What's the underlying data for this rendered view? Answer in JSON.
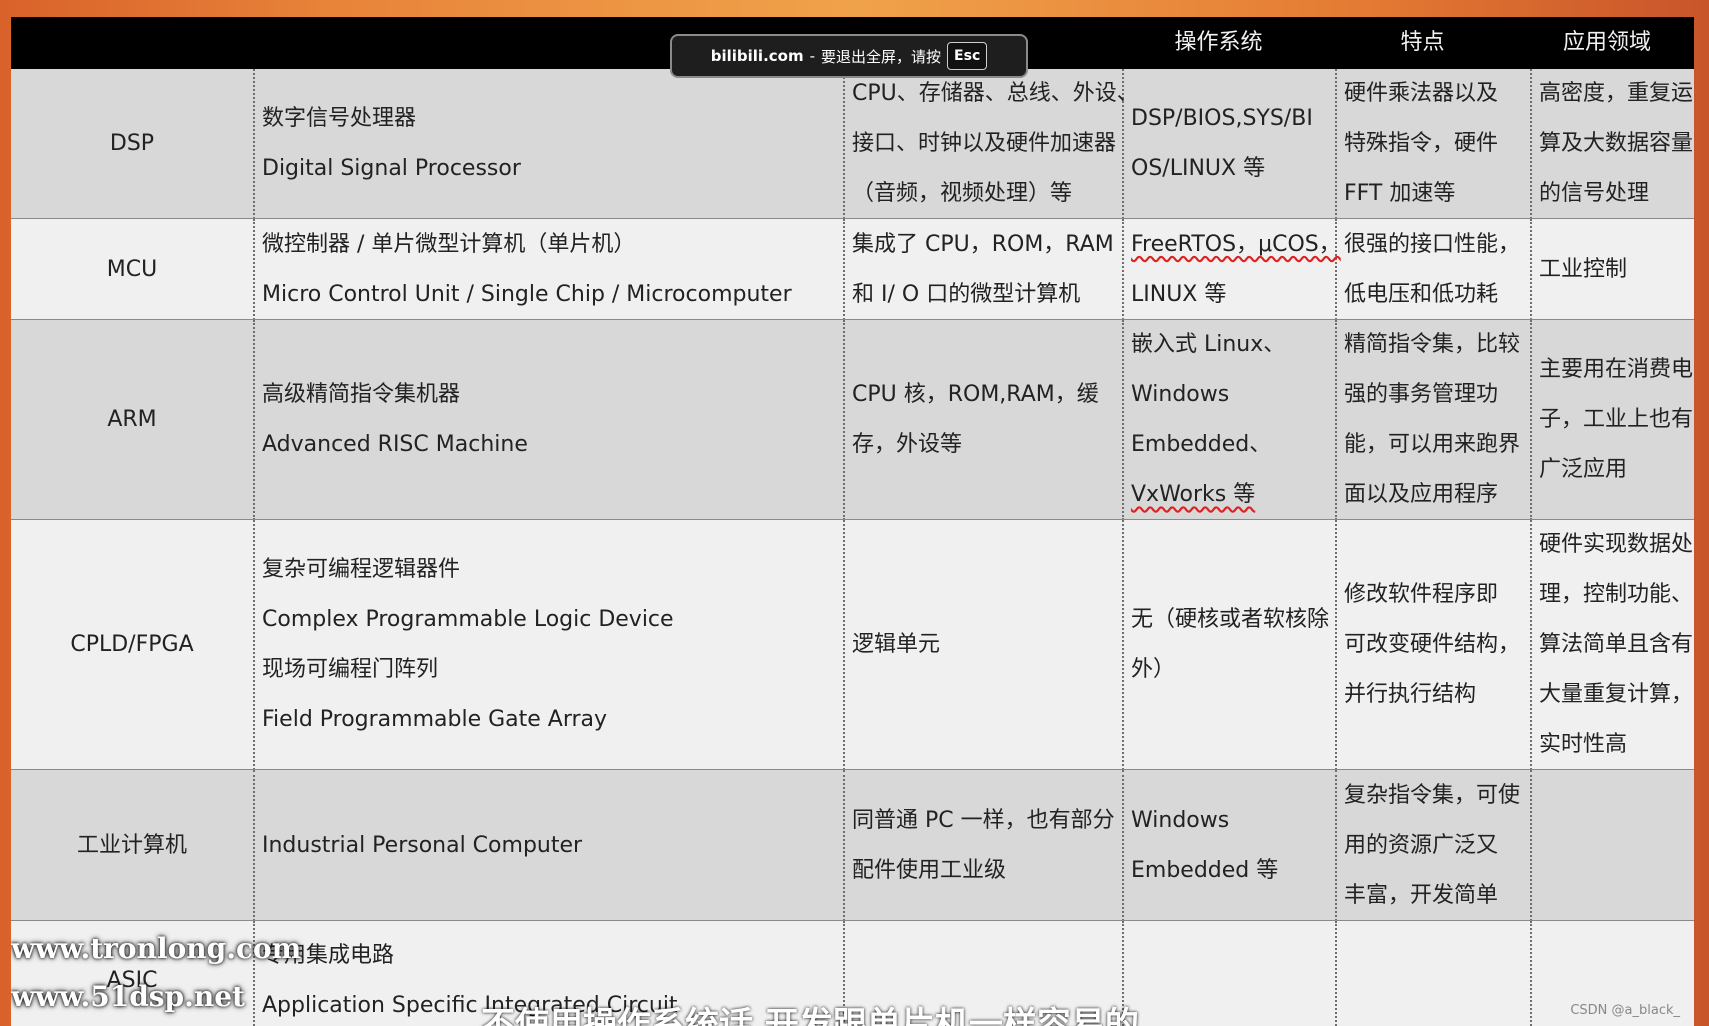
{
  "toast": {
    "site": "bilibili.com",
    "sep": "-",
    "message": "要退出全屏，请按",
    "key": "Esc"
  },
  "table": {
    "headers": [
      "",
      "",
      "",
      "操作系统",
      "特点",
      "应用领域"
    ],
    "rows": [
      {
        "name": [
          "DSP"
        ],
        "full": [
          "数字信号处理器",
          "Digital Signal Processor"
        ],
        "components": [
          "CPU、存储器、总线、外设、",
          "接口、时钟以及硬件加速器",
          "（音频，视频处理）等"
        ],
        "os": [
          "DSP/BIOS,SYS/BI",
          "OS/LINUX 等"
        ],
        "features": [
          "硬件乘法器以及",
          "特殊指令，硬件",
          "FFT 加速等"
        ],
        "applications": [
          "高密度，重复运",
          "算及大数据容量",
          "的信号处理"
        ]
      },
      {
        "name": [
          "MCU"
        ],
        "full": [
          "微控制器 / 单片微型计算机（单片机）",
          "Micro Control Unit / Single Chip / Microcomputer"
        ],
        "components": [
          "集成了 CPU，ROM，RAM",
          "和 I/ O  口的微型计算机"
        ],
        "os": [
          "FreeRTOS，μCOS，",
          "LINUX 等"
        ],
        "features": [
          "很强的接口性能，",
          "低电压和低功耗"
        ],
        "applications": [
          "工业控制"
        ]
      },
      {
        "name": [
          "ARM"
        ],
        "full": [
          "高级精简指令集机器",
          "Advanced RISC Machine"
        ],
        "components": [
          "CPU 核，ROM,RAM，缓",
          "存，外设等"
        ],
        "os": [
          "嵌入式 Linux、",
          "Windows",
          "Embedded、",
          "VxWorks 等"
        ],
        "features": [
          "精简指令集，比较",
          "强的事务管理功",
          "能，可以用来跑界",
          "面以及应用程序"
        ],
        "applications": [
          "主要用在消费电",
          "子，工业上也有",
          "广泛应用"
        ]
      },
      {
        "name": [
          "CPLD/FPGA"
        ],
        "full": [
          "复杂可编程逻辑器件",
          "Complex Programmable Logic Device",
          "现场可编程门阵列",
          "Field Programmable Gate Array"
        ],
        "components": [
          "逻辑单元"
        ],
        "os": [
          "无（硬核或者软核除",
          "外）"
        ],
        "features": [
          "修改软件程序即",
          "可改变硬件结构，",
          "并行执行结构"
        ],
        "applications": [
          "硬件实现数据处",
          "理，控制功能、",
          "算法简单且含有",
          "大量重复计算，",
          "实时性高"
        ]
      },
      {
        "name": [
          "工业计算机"
        ],
        "full": [
          "Industrial Personal Computer"
        ],
        "components": [
          "同普通 PC 一样，也有部分",
          "配件使用工业级"
        ],
        "os": [
          "Windows",
          "Embedded 等"
        ],
        "features": [
          "复杂指令集，可使",
          "用的资源广泛又",
          "丰富，开发简单"
        ],
        "applications": []
      },
      {
        "name": [
          "ASIC"
        ],
        "full": [
          "专用集成电路",
          "Application Specific Integrated Circuit"
        ],
        "components": [],
        "os": [],
        "features": [],
        "applications": []
      }
    ]
  },
  "watermarks": [
    "www.tronlong.com",
    "www.51dsp.net"
  ],
  "credit": "CSDN @a_black_",
  "subtitle": "不使用操作系统话 开发跟单片机一样容易的"
}
